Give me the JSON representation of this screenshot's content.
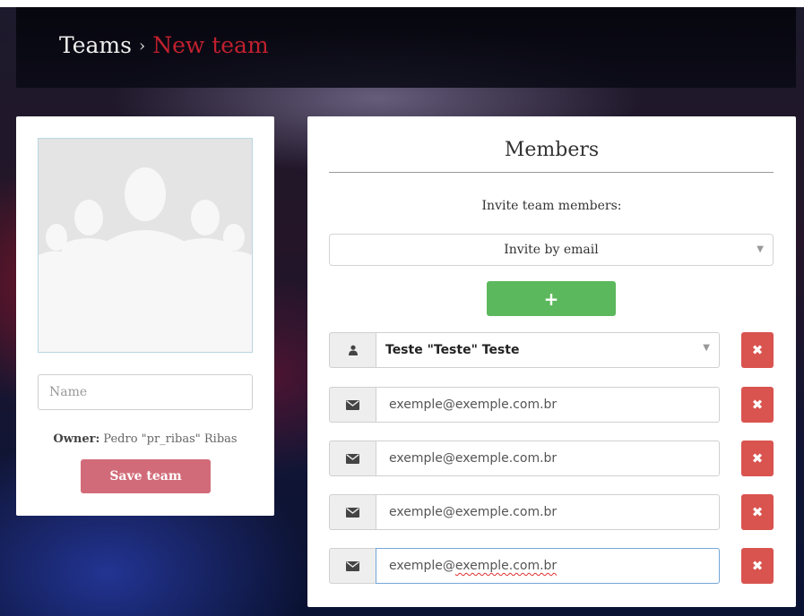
{
  "breadcrumb": {
    "root": "Teams",
    "separator": "›",
    "current": "New team"
  },
  "team_form": {
    "name_placeholder": "Name",
    "owner_label": "Owner:",
    "owner_value": "Pedro \"pr_ribas\" Ribas",
    "save_label": "Save team"
  },
  "members": {
    "title": "Members",
    "invite_label": "Invite team members:",
    "invite_select_value": "Invite by email",
    "add_button_label": "+",
    "user_member": {
      "icon": "user-icon",
      "value": "Teste \"Teste\" Teste"
    },
    "email_members": [
      {
        "icon": "envelope-icon",
        "value": "exemple@exemple.com.br"
      },
      {
        "icon": "envelope-icon",
        "value": "exemple@exemple.com.br"
      },
      {
        "icon": "envelope-icon",
        "value": "exemple@exemple.com.br"
      },
      {
        "icon": "envelope-icon",
        "value_prefix": "exemple@",
        "value_misspelled": "exemple.com.br"
      }
    ],
    "remove_label": "✖"
  },
  "colors": {
    "accent_red": "#c0202e",
    "save_button": "#d26b79",
    "add_button": "#5cb85c",
    "remove_button": "#d9534f"
  }
}
